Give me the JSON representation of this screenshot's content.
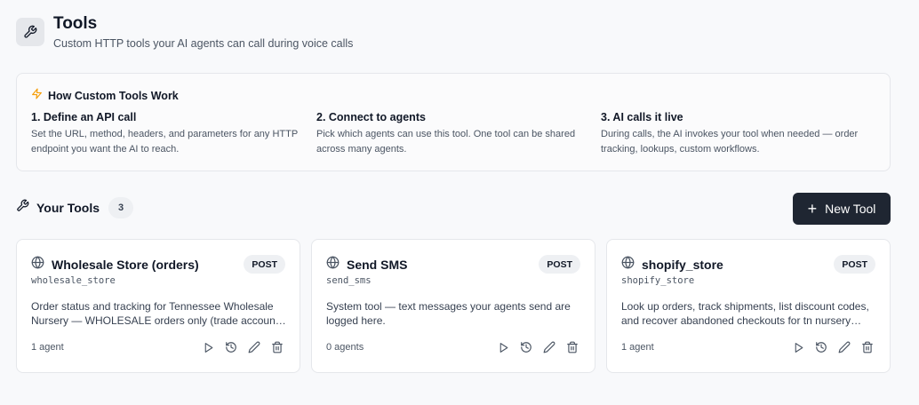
{
  "header": {
    "title": "Tools",
    "subtitle": "Custom HTTP tools your AI agents can call during voice calls",
    "icon": "wrench-icon"
  },
  "info": {
    "title": "How Custom Tools Work",
    "icon": "lightning-icon",
    "accent": "#f59e0b",
    "steps": [
      {
        "title": "1. Define an API call",
        "body": "Set the URL, method, headers, and parameters for any HTTP endpoint you want the AI to reach."
      },
      {
        "title": "2. Connect to agents",
        "body": "Pick which agents can use this tool. One tool can be shared across many agents."
      },
      {
        "title": "3. AI calls it live",
        "body": "During calls, the AI invokes your tool when needed — order tracking, lookups, custom workflows."
      }
    ]
  },
  "tools_section": {
    "title": "Your Tools",
    "count": "3",
    "new_button": "New Tool"
  },
  "tools": [
    {
      "name": "Wholesale Store (orders)",
      "slug": "wholesale_store",
      "method": "POST",
      "description": "Order status and tracking for Tennessee Wholesale Nursery — WHOLESALE orders only (trade account customers like landscapers and retailers).",
      "agents": "1 agent"
    },
    {
      "name": "Send SMS",
      "slug": "send_sms",
      "method": "POST",
      "description": "System tool — text messages your agents send are logged here.",
      "agents": "0 agents"
    },
    {
      "name": "shopify_store",
      "slug": "shopify_store",
      "method": "POST",
      "description": "Look up orders, track shipments, list discount codes, and recover abandoned checkouts for tn nursery customers.",
      "agents": "1 agent"
    }
  ],
  "colors": {
    "primary_button": "#1f2632",
    "background": "#f8f9fb",
    "border": "#e5e7eb"
  }
}
